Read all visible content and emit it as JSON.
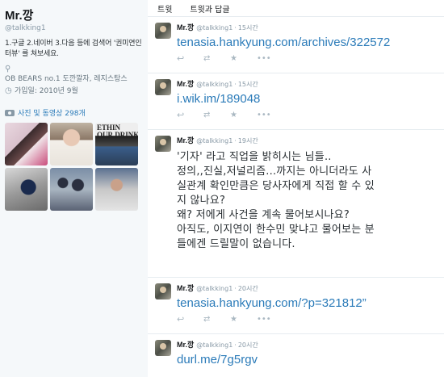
{
  "profile": {
    "name": "Mr.깡",
    "handle": "@talkking1",
    "bio": "1.구글 2.네이버 3.다음 등에 검색어 '권미연인터뷰' 를 쳐보세요.",
    "location": "OB BEARS no.1 도깐깔자, 레지스탕스",
    "joined": "가입일: 2010년 9월",
    "photos_label": "사진 및 동영상 298개",
    "thumb3_text": "ETHIN\nOUR DRINK"
  },
  "tabs": [
    {
      "label": "트윗"
    },
    {
      "label": "트윗과 답글"
    }
  ],
  "tweets": [
    {
      "name": "Mr.깡",
      "handle": "@talkking1",
      "time": "15시간",
      "link": "tenasia.hankyung.com/archives/322572"
    },
    {
      "name": "Mr.깡",
      "handle": "@talkking1",
      "time": "15시간",
      "link": "i.wik.im/189048"
    },
    {
      "name": "Mr.깡",
      "handle": "@talkking1",
      "time": "19시간",
      "lines": [
        "'기자' 라고 직업을 밝히시는 님들..",
        "정의,,진실,저널리즘...까지는 아니더라도 사",
        "실관계 확인만큼은 당사자에게 직접 할 수 있",
        "지 않나요?",
        "왜? 저에게 사건을 계속 물어보시나요?",
        "아직도, 이지연이 한수민 맞냐고 물어보는 분",
        "들에겐 드릴말이 없습니다."
      ]
    },
    {
      "name": "Mr.깡",
      "handle": "@talkking1",
      "time": "20시간",
      "link": "tenasia.hankyung.com/?p=321812”"
    },
    {
      "name": "Mr.깡",
      "handle": "@talkking1",
      "time": "20시간",
      "link": "durl.me/7g5rgv"
    }
  ],
  "icons": {
    "reply": "↩",
    "retweet": "⇄",
    "favorite": "★",
    "more": "•••",
    "location": "⚲",
    "calendar": "◷"
  }
}
